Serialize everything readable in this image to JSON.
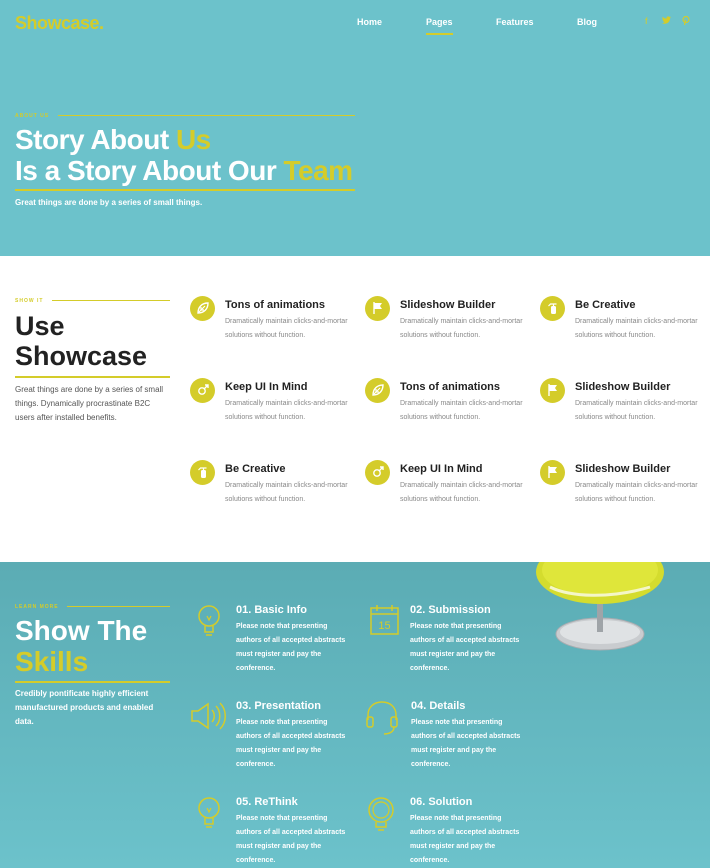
{
  "brand": {
    "logo": "Showcase."
  },
  "nav": {
    "items": [
      {
        "label": "Home"
      },
      {
        "label": "Pages"
      },
      {
        "label": "Features"
      },
      {
        "label": "Blog"
      }
    ],
    "active_index": 1,
    "social": [
      "facebook-icon",
      "twitter-icon",
      "pinterest-icon"
    ]
  },
  "hero": {
    "kicker": "ABOUT US",
    "title_line1_a": "Story About ",
    "title_line1_b": "Us",
    "title_line2_a": "Is a Story About Our ",
    "title_line2_b": "Team",
    "subtitle": "Great things are done by a series of small things."
  },
  "showcase": {
    "kicker": "SHOW IT",
    "title_line1": "Use",
    "title_line2": "Showcase",
    "description": "Great things are done by a series of small things. Dynamically procrastinate B2C users after installed benefits.",
    "features": [
      {
        "title": "Tons of animations",
        "desc": "Dramatically maintain clicks-and-mortar solutions without function.",
        "icon": "leaf-icon"
      },
      {
        "title": "Slideshow Builder",
        "desc": "Dramatically maintain clicks-and-mortar solutions without function.",
        "icon": "flag-icon"
      },
      {
        "title": "Be Creative",
        "desc": "Dramatically maintain clicks-and-mortar solutions without function.",
        "icon": "fire-extinguisher-icon"
      },
      {
        "title": "Keep UI In Mind",
        "desc": "Dramatically maintain clicks-and-mortar solutions without function.",
        "icon": "cursor-icon"
      },
      {
        "title": "Tons of animations",
        "desc": "Dramatically maintain clicks-and-mortar solutions without function.",
        "icon": "leaf-icon"
      },
      {
        "title": "Slideshow Builder",
        "desc": "Dramatically maintain clicks-and-mortar solutions without function.",
        "icon": "flag-icon"
      },
      {
        "title": "Be Creative",
        "desc": "Dramatically maintain clicks-and-mortar solutions without function.",
        "icon": "fire-extinguisher-icon"
      },
      {
        "title": "Keep UI In Mind",
        "desc": "Dramatically maintain clicks-and-mortar solutions without function.",
        "icon": "cursor-icon"
      },
      {
        "title": "Slideshow Builder",
        "desc": "Dramatically maintain clicks-and-mortar solutions without function.",
        "icon": "flag-icon"
      }
    ]
  },
  "skills": {
    "kicker": "LEARN MORE",
    "title_line1": "Show The",
    "title_line2": "Skills",
    "description": "Credibly pontificate highly efficient manufactured products and enabled data.",
    "steps": [
      {
        "title": "01. Basic Info",
        "desc": "Please note that presenting authors of all accepted abstracts must register and pay the conference.",
        "icon": "lightbulb-icon"
      },
      {
        "title": "02. Submission",
        "desc": "Please note that presenting authors of all accepted abstracts must register and pay the conference.",
        "icon": "calendar-icon",
        "icon_text": "15"
      },
      {
        "title": "03. Presentation",
        "desc": "Please note that presenting authors of all accepted abstracts must register and pay the conference.",
        "icon": "megaphone-icon"
      },
      {
        "title": "04. Details",
        "desc": "Please note that presenting authors of all accepted abstracts must register and pay the conference.",
        "icon": "headset-icon"
      },
      {
        "title": "05. ReThink",
        "desc": "Please note that presenting authors of all accepted abstracts must register and pay the conference.",
        "icon": "lightbulb-icon"
      },
      {
        "title": "06. Solution",
        "desc": "Please note that presenting authors of all accepted abstracts must register and pay the conference.",
        "icon": "bulb-round-icon"
      }
    ]
  },
  "colors": {
    "accent": "#d4cc2a",
    "hero_bg": "#6cc2cb",
    "dark_text": "#222222"
  }
}
